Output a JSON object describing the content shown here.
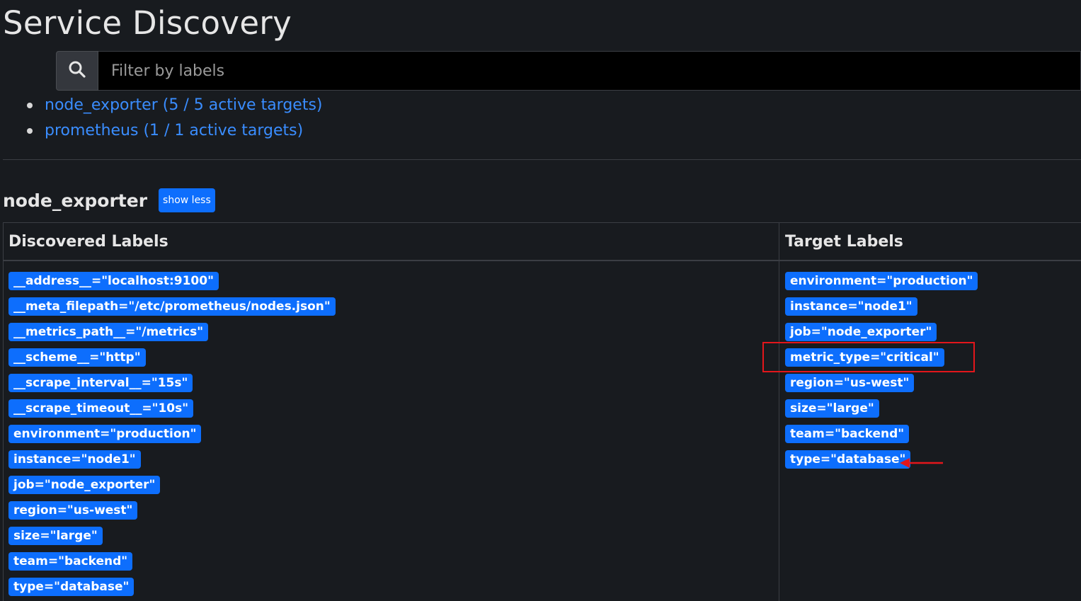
{
  "page": {
    "title": "Service Discovery"
  },
  "search": {
    "placeholder": "Filter by labels",
    "value": "",
    "icon": "search-icon"
  },
  "jobs": [
    {
      "label": "node_exporter (5 / 5 active targets)"
    },
    {
      "label": "prometheus (1 / 1 active targets)"
    }
  ],
  "section": {
    "title": "node_exporter",
    "toggle_label": "show less"
  },
  "table": {
    "headers": {
      "discovered": "Discovered Labels",
      "target": "Target Labels"
    },
    "discovered_labels": [
      "__address__=\"localhost:9100\"",
      "__meta_filepath=\"/etc/prometheus/nodes.json\"",
      "__metrics_path__=\"/metrics\"",
      "__scheme__=\"http\"",
      "__scrape_interval__=\"15s\"",
      "__scrape_timeout__=\"10s\"",
      "environment=\"production\"",
      "instance=\"node1\"",
      "job=\"node_exporter\"",
      "region=\"us-west\"",
      "size=\"large\"",
      "team=\"backend\"",
      "type=\"database\""
    ],
    "target_labels": [
      "environment=\"production\"",
      "instance=\"node1\"",
      "job=\"node_exporter\"",
      "metric_type=\"critical\"",
      "region=\"us-west\"",
      "size=\"large\"",
      "team=\"backend\"",
      "type=\"database\""
    ]
  },
  "colors": {
    "background": "#181b1f",
    "link": "#3a8dff",
    "badge": "#0d6efd",
    "annotation": "#e3161b"
  }
}
